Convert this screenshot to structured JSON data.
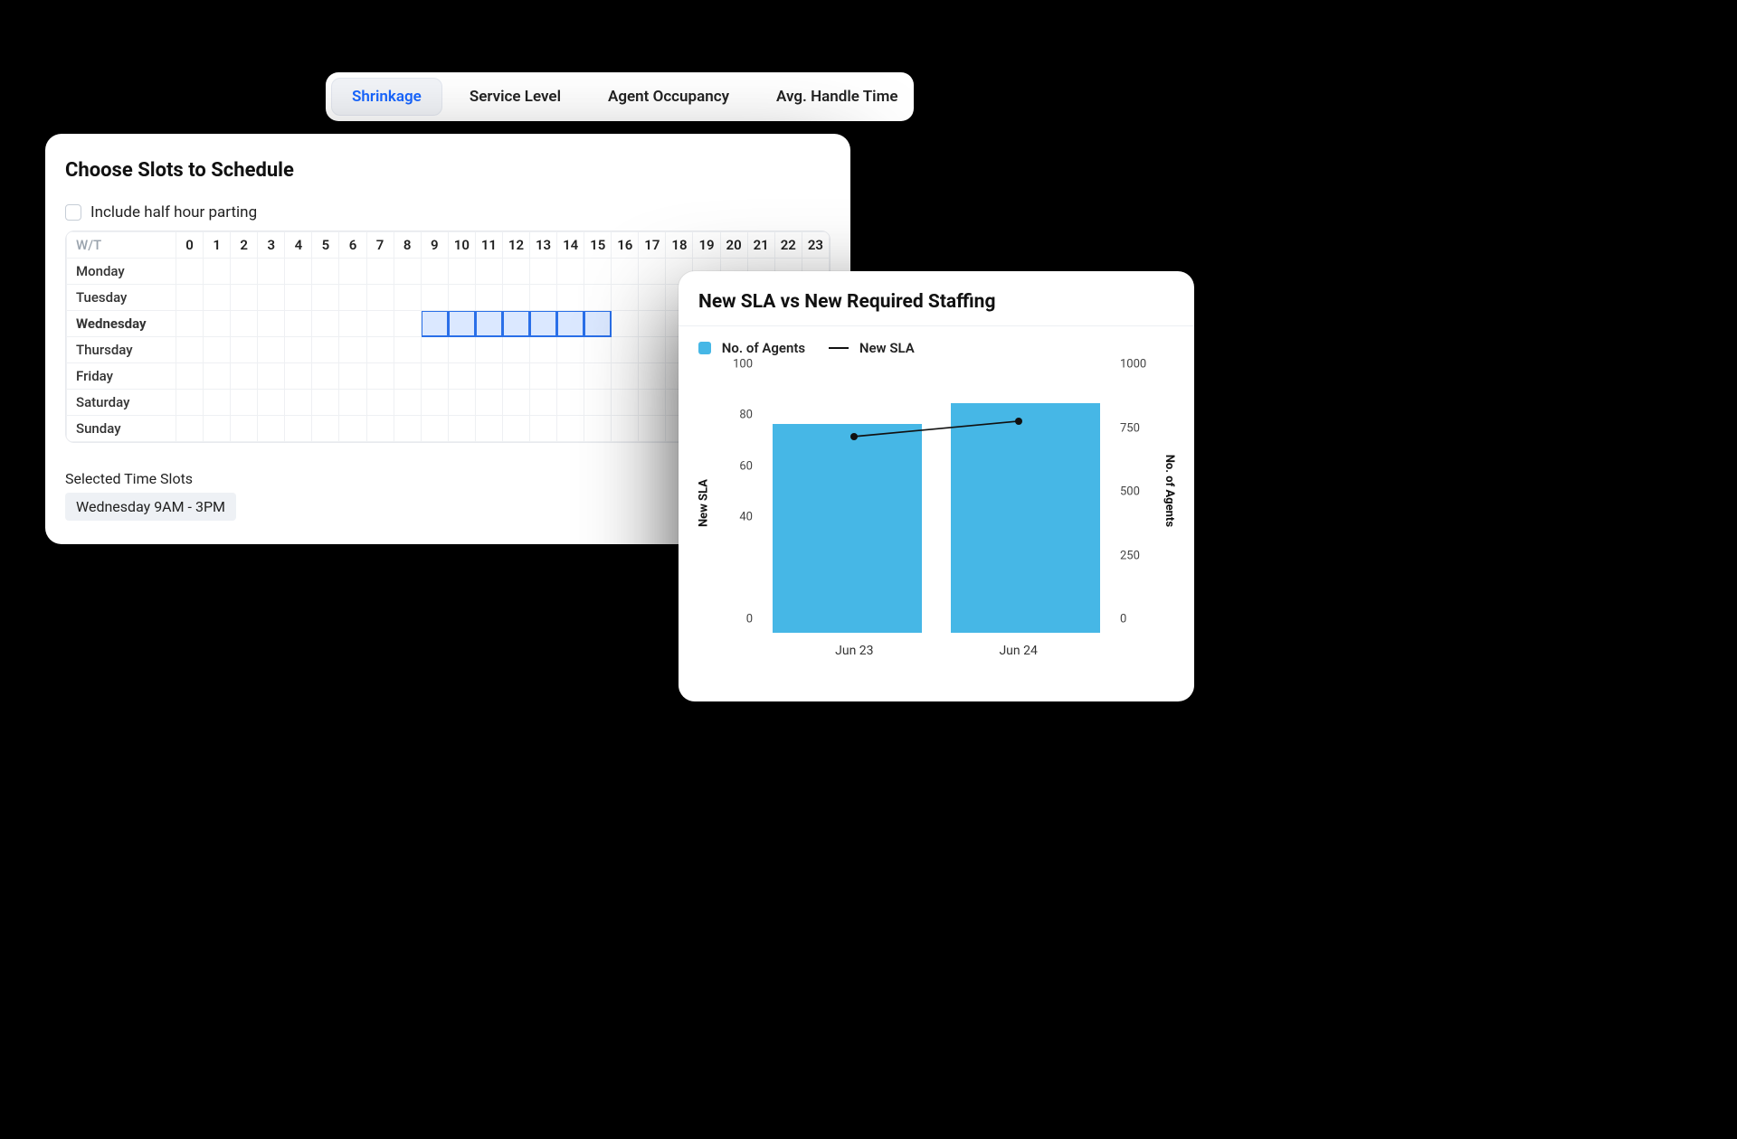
{
  "tabs": [
    {
      "label": "Shrinkage",
      "active": true
    },
    {
      "label": "Service Level",
      "active": false
    },
    {
      "label": "Agent Occupancy",
      "active": false
    },
    {
      "label": "Avg. Handle Time",
      "active": false
    }
  ],
  "scheduler": {
    "title": "Choose Slots to Schedule",
    "include_half_hour_label": "Include half hour parting",
    "include_half_hour_checked": false,
    "corner_label": "W/T",
    "hours": [
      "0",
      "1",
      "2",
      "3",
      "4",
      "5",
      "6",
      "7",
      "8",
      "9",
      "10",
      "11",
      "12",
      "13",
      "14",
      "15",
      "16",
      "17",
      "18",
      "19",
      "20",
      "21",
      "22",
      "23"
    ],
    "days": [
      "Monday",
      "Tuesday",
      "Wednesday",
      "Thursday",
      "Friday",
      "Saturday",
      "Sunday"
    ],
    "selected": {
      "day": "Wednesday",
      "hours": [
        9,
        10,
        11,
        12,
        13,
        14,
        15
      ]
    },
    "summary_label": "Selected Time Slots",
    "summary_value": "Wednesday 9AM - 3PM"
  },
  "chart": {
    "title": "New SLA vs New Required Staffing",
    "legend": {
      "bar_series": "No. of Agents",
      "line_series": "New SLA"
    },
    "left_axis_label": "New SLA",
    "right_axis_label": "No. of Agents",
    "left_ticks": [
      0,
      40,
      60,
      80,
      100
    ],
    "right_ticks": [
      0,
      250,
      500,
      750,
      1000
    ],
    "categories": [
      "Jun 23",
      "Jun 24"
    ]
  },
  "chart_data": {
    "type": "bar",
    "title": "New SLA vs New Required Staffing",
    "categories": [
      "Jun 23",
      "Jun 24"
    ],
    "x": [
      "Jun 23",
      "Jun 24"
    ],
    "left_axis": {
      "label": "New SLA",
      "range": [
        0,
        100
      ],
      "ticks": [
        0,
        40,
        60,
        80,
        100
      ]
    },
    "right_axis": {
      "label": "No. of Agents",
      "range": [
        0,
        1000
      ],
      "ticks": [
        0,
        250,
        500,
        750,
        1000
      ]
    },
    "series": [
      {
        "name": "No. of Agents",
        "kind": "bar",
        "axis": "right",
        "values": [
          820,
          900
        ]
      },
      {
        "name": "New SLA",
        "kind": "line",
        "axis": "left",
        "values": [
          77,
          83
        ]
      }
    ],
    "legend_position": "top-left"
  }
}
